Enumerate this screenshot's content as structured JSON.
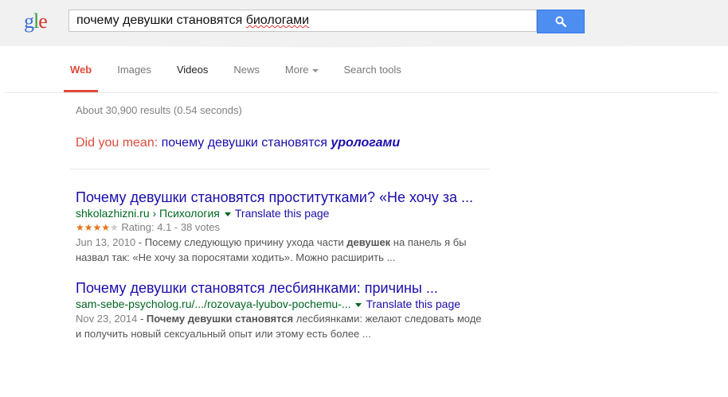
{
  "logo": {
    "g": "g",
    "l": "l",
    "e": "e"
  },
  "search": {
    "query_before": "почему девушки становятся ",
    "query_misspelled": "биологами"
  },
  "tabs": [
    {
      "label": "Web"
    },
    {
      "label": "Images"
    },
    {
      "label": "Videos"
    },
    {
      "label": "News"
    },
    {
      "label": "More"
    },
    {
      "label": "Search tools"
    }
  ],
  "stats": "About 30,900 results (0.54 seconds)",
  "did_you_mean": {
    "label": "Did you mean:",
    "prefix": "почему девушки становятся",
    "suggestion": "урологами"
  },
  "results": [
    {
      "title": "Почему девушки становятся проститутками? «Не хочу за ...",
      "url": "shkolazhizni.ru › Психология",
      "translate": "Translate this page",
      "rating": "Rating: 4.1 - 38 votes",
      "date": "Jun 13, 2010",
      "snippet_a": " - Посему следующую причину ухода части ",
      "snippet_b": "девушек",
      "snippet_c": " на панель я бы назвал так: «Не хочу за поросятами ходить». Можно расширить ..."
    },
    {
      "title": "Почему девушки становятся лесбиянками: причины ...",
      "url": "sam-sebe-psycholog.ru/.../rozovaya-lyubov-pochemu-...",
      "translate": "Translate this page",
      "date": "Nov 23, 2014",
      "snippet_a": " - ",
      "snippet_b": "Почему девушки становятся",
      "snippet_c": " лесбиянками: желают следовать моде и получить новый сексуальный опыт или этому есть более ..."
    }
  ],
  "colors": {
    "accent": "#dd4b39",
    "link": "#1a0dab",
    "url": "#006621",
    "button": "#4d8ef0"
  }
}
